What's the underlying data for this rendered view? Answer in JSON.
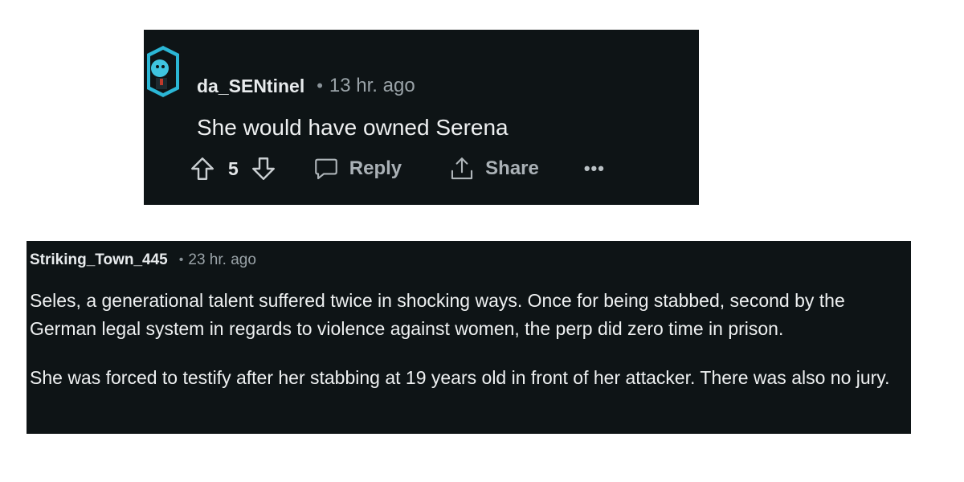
{
  "comment1": {
    "username": "da_SENtinel",
    "separator": "•",
    "time": "13 hr. ago",
    "body": "She would have owned Serena",
    "score": "5",
    "reply_label": "Reply",
    "share_label": "Share",
    "more_label": "•••",
    "icons": {
      "upvote": "arrow-up-outline-icon",
      "downvote": "arrow-down-outline-icon",
      "reply": "speech-bubble-icon",
      "share": "share-upload-icon"
    }
  },
  "comment2": {
    "username": "Striking_Town_445",
    "separator": "•",
    "time": "23 hr. ago",
    "paragraphs": [
      "Seles, a generational talent suffered twice in shocking ways. Once for being stabbed, second by the German legal system in regards to violence against women, the perp did zero time in prison.",
      "She was forced to testify after her stabbing at 19 years old in front of her attacker. There was also no jury."
    ]
  },
  "colors": {
    "card_background": "#0e1416",
    "page_background": "#ffffff",
    "avatar_accent": "#2bb7d6"
  }
}
